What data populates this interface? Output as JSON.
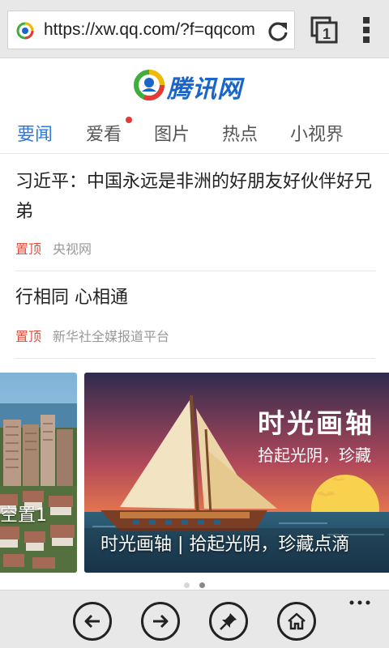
{
  "browser": {
    "url": "https://xw.qq.com/?f=qqcom",
    "tab_count": "1"
  },
  "site": {
    "logo_text": "腾讯网",
    "brand_colors": {
      "blue": "#1a66c8",
      "green": "#3fae3a",
      "red": "#e53935",
      "yellow": "#f5b800"
    }
  },
  "nav": {
    "items": [
      {
        "label": "要闻",
        "active": true
      },
      {
        "label": "爱看",
        "badge": true
      },
      {
        "label": "图片"
      },
      {
        "label": "热点"
      },
      {
        "label": "小视界"
      }
    ]
  },
  "articles": [
    {
      "title": "习近平：中国永远是非洲的好朋友好伙伴好兄弟",
      "tag": "置顶",
      "source": "央视网"
    },
    {
      "title": "行相同 心相通",
      "tag": "置顶",
      "source": "新华社全媒报道平台"
    }
  ],
  "carousel": {
    "slides": [
      {
        "caption": "空置1",
        "scene": "aerial-residential-buildings"
      },
      {
        "poster_title": "时光画轴",
        "poster_subtitle": "拾起光阴，珍藏",
        "caption": "时光画轴 | 拾起光阴，珍藏点滴",
        "scene": "sailboat-sunset"
      }
    ],
    "active_index": 1
  },
  "toolbar": {
    "buttons": [
      "back-icon",
      "forward-icon",
      "pin-icon",
      "home-icon"
    ],
    "more": "more-icon"
  },
  "colors": {
    "accent": "#2c7be5",
    "tag": "#e04c3c",
    "source": "#999999",
    "chrome_bg": "#e8e8e8"
  }
}
